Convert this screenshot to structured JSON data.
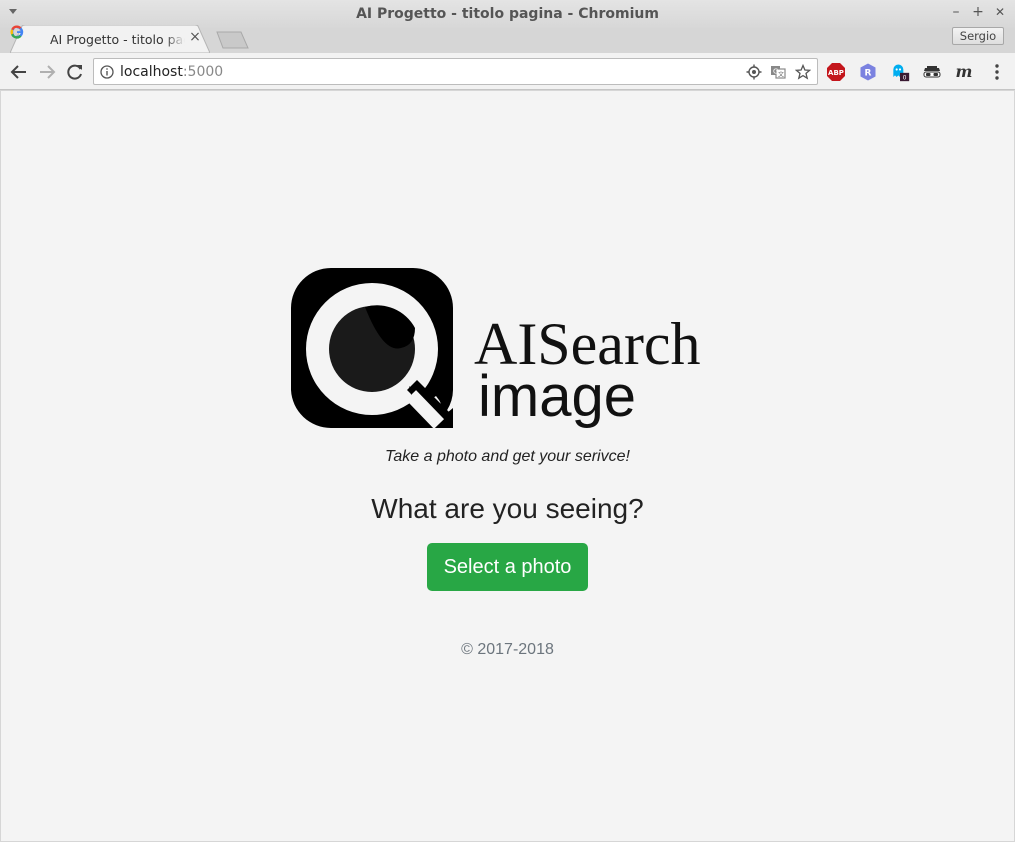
{
  "window": {
    "title": "AI Progetto - titolo pagina - Chromium",
    "minimize": "–",
    "maximize": "+",
    "close": "✕"
  },
  "tab": {
    "title": "AI Progetto - titolo pagina - Chromium",
    "close": "×"
  },
  "profile": {
    "name": "Sergio"
  },
  "address_bar": {
    "host": "localhost",
    "port": ":5000"
  },
  "extensions": [
    {
      "name": "adblock-plus-icon",
      "label": "ABP"
    },
    {
      "name": "r-extension-icon",
      "label": "R"
    },
    {
      "name": "ghostery-icon",
      "badge": "0"
    },
    {
      "name": "incognito-mask-icon"
    },
    {
      "name": "m-extension-icon",
      "label": "m"
    }
  ],
  "page": {
    "logo": {
      "line1": "AISearch",
      "line2": "image"
    },
    "tagline": "Take a photo and get your serivce!",
    "heading": "What are you seeing?",
    "select_button": "Select a photo",
    "footer": "© 2017-2018"
  },
  "colors": {
    "accent_green": "#28a745",
    "footer_text": "#6c757d",
    "page_bg": "#f4f4f4"
  }
}
